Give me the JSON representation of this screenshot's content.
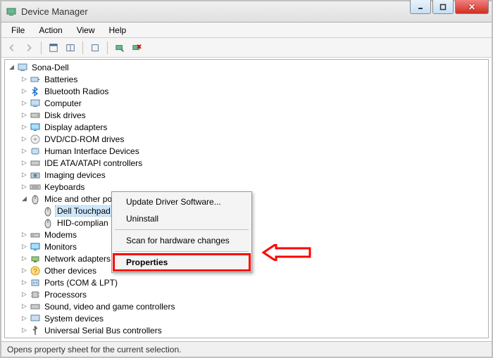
{
  "window": {
    "title": "Device Manager"
  },
  "menu": {
    "file": "File",
    "action": "Action",
    "view": "View",
    "help": "Help"
  },
  "tree": {
    "root": "Sona-Dell",
    "items": [
      "Batteries",
      "Bluetooth Radios",
      "Computer",
      "Disk drives",
      "Display adapters",
      "DVD/CD-ROM drives",
      "Human Interface Devices",
      "IDE ATA/ATAPI controllers",
      "Imaging devices",
      "Keyboards"
    ],
    "mice_label": "Mice and other pointing devices",
    "mice_children": {
      "dell": "Dell Touchpad",
      "hid": "HID-complian"
    },
    "items_after": [
      "Modems",
      "Monitors",
      "Network adapters",
      "Other devices",
      "Ports (COM & LPT)",
      "Processors",
      "Sound, video and game controllers",
      "System devices",
      "Universal Serial Bus controllers"
    ]
  },
  "context_menu": {
    "update": "Update Driver Software...",
    "uninstall": "Uninstall",
    "scan": "Scan for hardware changes",
    "properties": "Properties"
  },
  "status": {
    "text": "Opens property sheet for the current selection."
  }
}
